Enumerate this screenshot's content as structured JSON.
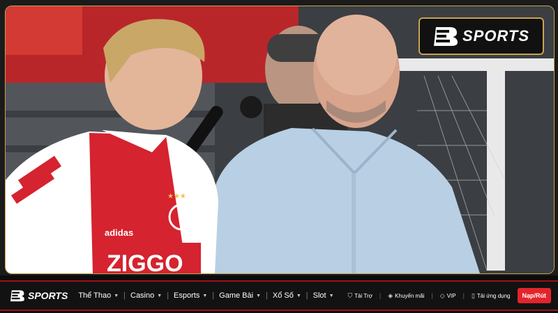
{
  "brand": {
    "name": "SPORTS"
  },
  "jersey": {
    "sponsor": "ZIGGO",
    "maker": "adidas"
  },
  "nav": {
    "items": [
      {
        "label": "Thể Thao"
      },
      {
        "label": "Casino"
      },
      {
        "label": "Esports"
      },
      {
        "label": "Game Bài"
      },
      {
        "label": "Xổ Số"
      },
      {
        "label": "Slot"
      }
    ]
  },
  "utils": {
    "items": [
      {
        "label": "Tài Trợ",
        "icon": "shield-icon"
      },
      {
        "label": "Khuyến mãi",
        "icon": "tag-icon"
      },
      {
        "label": "VIP",
        "icon": "diamond-icon"
      },
      {
        "label": "Tải ứng dụng",
        "icon": "phone-icon"
      }
    ],
    "cta_label": "Nạp/Rút"
  },
  "colors": {
    "accent_red": "#e3242b",
    "gold_border": "#c9a44a",
    "bar_bg": "#121213"
  }
}
